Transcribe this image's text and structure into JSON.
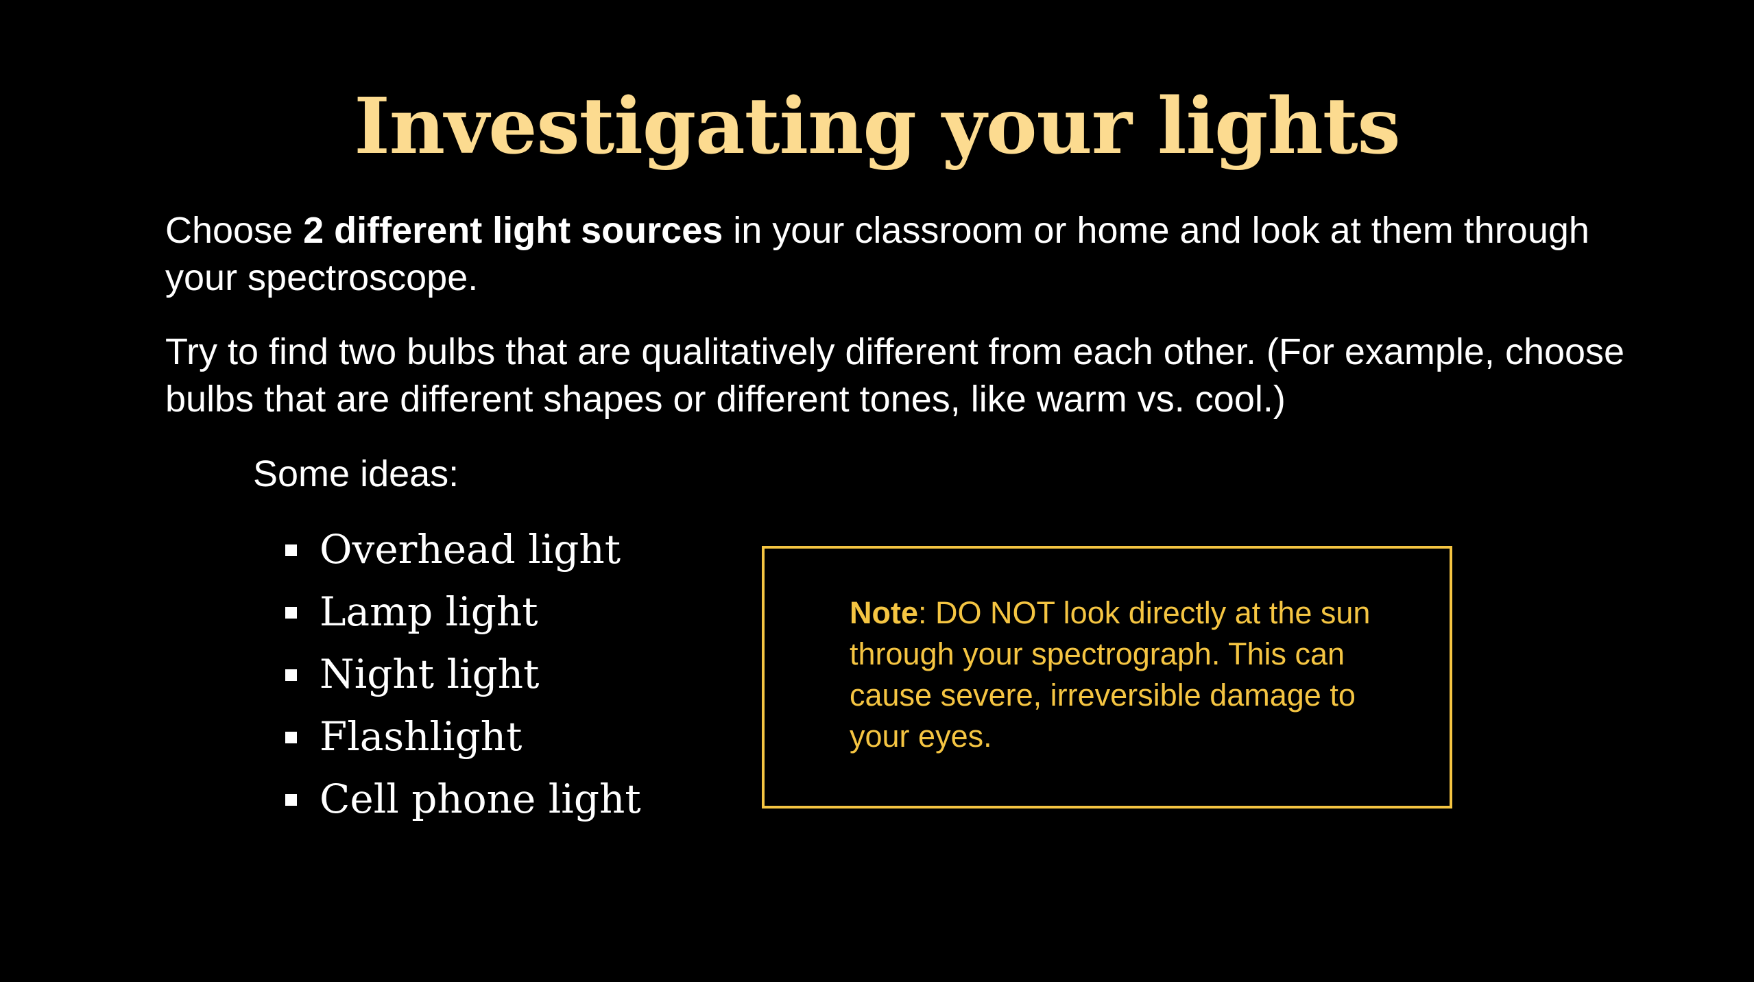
{
  "title": "Investigating your lights",
  "paragraph1": {
    "pre": "Choose ",
    "bold": "2 different light sources",
    "post": " in your classroom or home and look at them through your spectroscope."
  },
  "paragraph2": "Try to find two bulbs that are qualitatively different from each other. (For example, choose bulbs that are different shapes or different tones, like warm vs. cool.)",
  "ideas": {
    "label": "Some ideas:",
    "items": [
      "Overhead light",
      "Lamp light",
      "Night light",
      "Flashlight",
      "Cell phone light"
    ]
  },
  "note": {
    "label": "Note",
    "text": ": DO NOT look directly at the sun through your spectrograph. This can cause severe, irreversible damage to your eyes."
  },
  "colors": {
    "background": "#000000",
    "title": "#FCDB90",
    "body_text": "#FFFFFF",
    "note_accent": "#F5C542"
  }
}
